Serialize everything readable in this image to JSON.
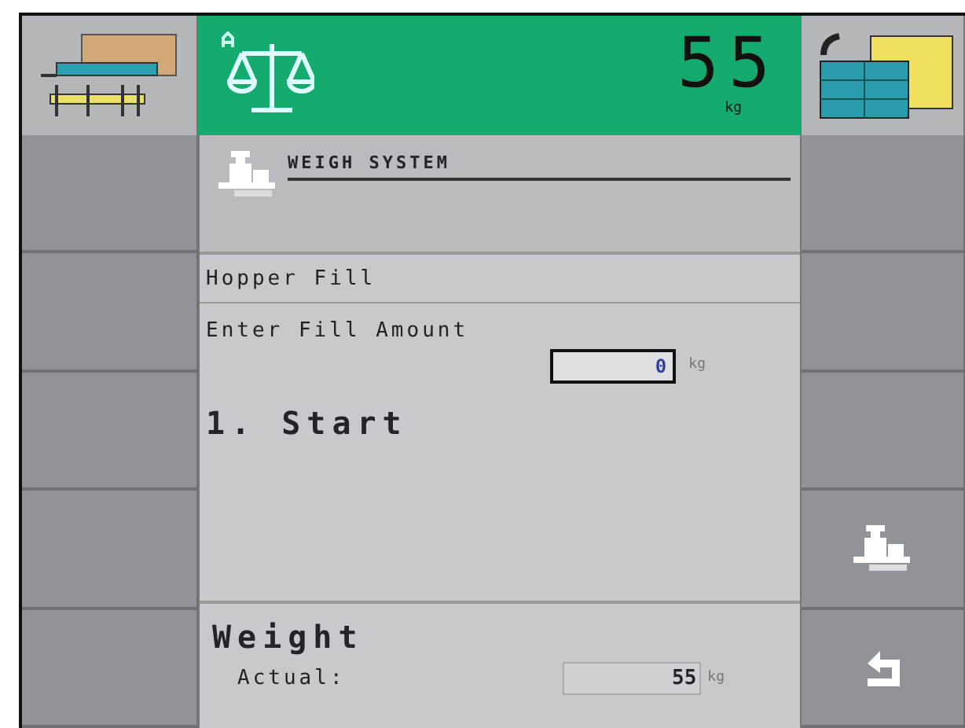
{
  "header": {
    "value": "55",
    "unit": "kg"
  },
  "title": "WEIGH SYSTEM",
  "section": "Hopper Fill",
  "fill": {
    "label": "Enter Fill Amount",
    "value": "0",
    "unit": "kg"
  },
  "step": "1. Start",
  "weight": {
    "heading": "Weight",
    "label": "Actual:",
    "value": "55",
    "unit": "kg"
  },
  "right_keys": [
    {
      "kind": "empty"
    },
    {
      "kind": "empty"
    },
    {
      "kind": "empty"
    },
    {
      "kind": "weigh"
    },
    {
      "kind": "back"
    }
  ]
}
